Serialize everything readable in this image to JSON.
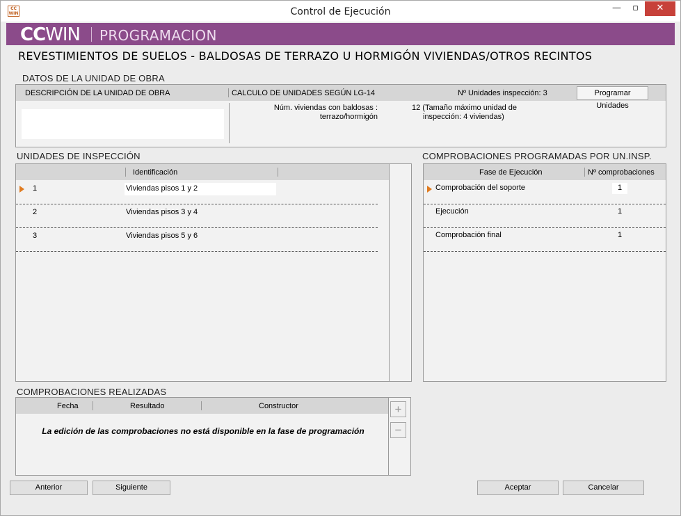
{
  "window": {
    "title": "Control de Ejecución",
    "icon_text": "CC WIN",
    "min_glyph": "—",
    "max_glyph": "▫",
    "close_glyph": "✕"
  },
  "banner": {
    "logo_cc": "CC",
    "logo_win": "WIN",
    "mode": "PROGRAMACION",
    "color": "#8b4b8a"
  },
  "main_title": "REVESTIMIENTOS DE SUELOS - BALDOSAS DE TERRAZO U HORMIGÓN  VIVIENDAS/OTROS RECINTOS",
  "datos": {
    "section_title": "DATOS DE LA UNIDAD DE OBRA",
    "col_descripcion": "DESCRIPCIÓN DE LA UNIDAD DE OBRA",
    "col_calculo": "CALCULO DE UNIDADES SEGÚN LG-14",
    "units_label": "Nº Unidades inspección: 3",
    "program_button": "Programar Unidades",
    "descripcion_value": "",
    "calc_label_line1": "Núm. viviendas con baldosas :",
    "calc_label_line2": "terrazo/hormigón",
    "calc_value_line1": "12 (Tamaño máximo unidad de",
    "calc_value_line2": "inspección: 4 viviendas)"
  },
  "unidades": {
    "section_title": "UNIDADES DE INSPECCIÓN",
    "col_identificacion": "Identificación",
    "rows": [
      {
        "num": "1",
        "ident": "Viviendas pisos 1 y 2"
      },
      {
        "num": "2",
        "ident": "Viviendas pisos 3 y 4"
      },
      {
        "num": "3",
        "ident": "Viviendas pisos 5 y 6"
      }
    ]
  },
  "comprobaciones_prog": {
    "section_title": "COMPROBACIONES PROGRAMADAS POR UN.INSP.",
    "col_fase": "Fase de Ejecución",
    "col_num": "Nº comprobaciones",
    "rows": [
      {
        "fase": "Comprobación del soporte",
        "num": "1"
      },
      {
        "fase": "Ejecución",
        "num": "1"
      },
      {
        "fase": "Comprobación final",
        "num": "1"
      }
    ]
  },
  "realizadas": {
    "section_title": "COMPROBACIONES REALIZADAS",
    "col_fecha": "Fecha",
    "col_resultado": "Resultado",
    "col_constructor": "Constructor",
    "message": "La edición de las comprobaciones no está disponible en la fase de programación",
    "add_glyph": "+",
    "remove_glyph": "−"
  },
  "footer": {
    "anterior": "Anterior",
    "siguiente": "Siguiente",
    "aceptar": "Aceptar",
    "cancelar": "Cancelar"
  },
  "colors": {
    "accent_arrow": "#e07b20",
    "close_button": "#c7413a"
  }
}
